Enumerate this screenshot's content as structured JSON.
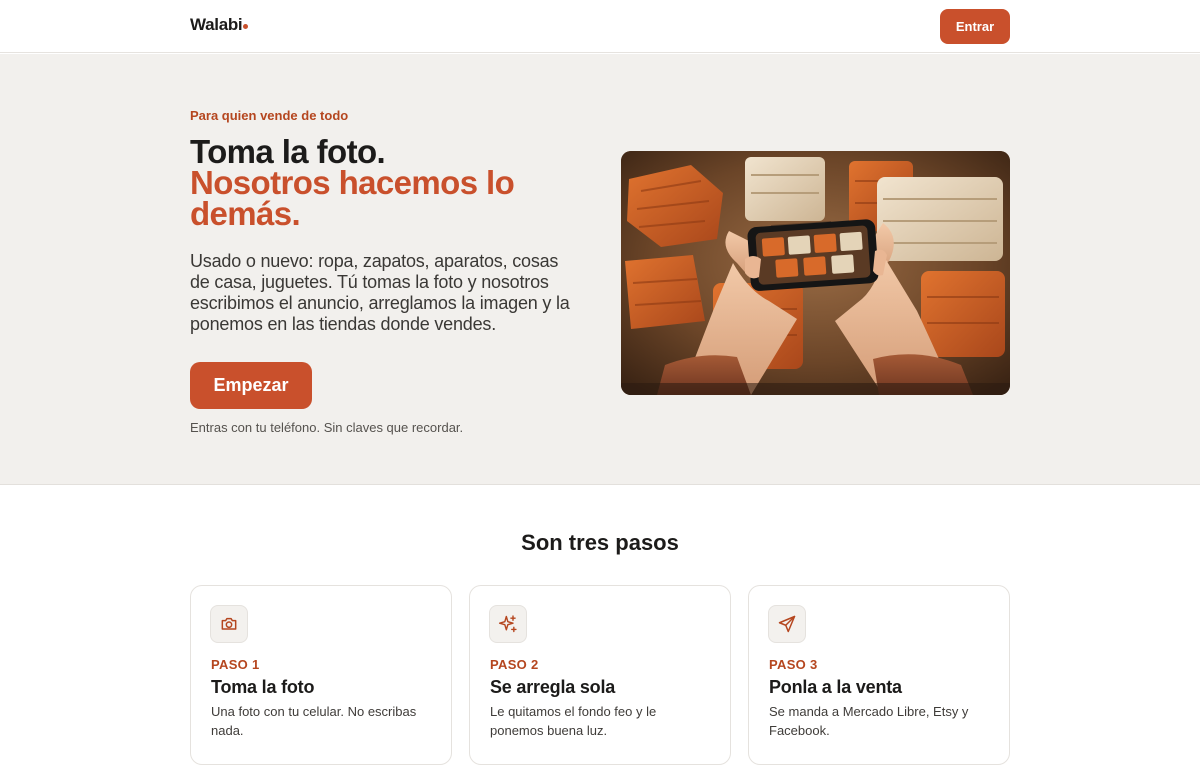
{
  "brand": {
    "name": "Walabi",
    "accent": "#c9502c"
  },
  "header": {
    "login_label": "Entrar"
  },
  "hero": {
    "eyebrow": "Para quien vende de todo",
    "title_line1": "Toma la foto.",
    "title_line2": "Nosotros hacemos lo demás.",
    "description": "Usado o nuevo: ropa, zapatos, aparatos, cosas de casa, juguetes. Tú tomas la foto y nosotros escribimos el anuncio, arreglamos la imagen y la ponemos en las tiendas donde vendes.",
    "cta_label": "Empezar",
    "note": "Entras con tu teléfono. Sin claves que recordar.",
    "image_icon": "hands-photographing-clothes-image"
  },
  "steps": {
    "title": "Son tres pasos",
    "items": [
      {
        "icon": "camera-icon",
        "label": "PASO 1",
        "title": "Toma la foto",
        "desc": "Una foto con tu celular. No escribas nada."
      },
      {
        "icon": "sparkles-icon",
        "label": "PASO 2",
        "title": "Se arregla sola",
        "desc": "Le quitamos el fondo feo y le ponemos buena luz."
      },
      {
        "icon": "send-icon",
        "label": "PASO 3",
        "title": "Ponla a la venta",
        "desc": "Se manda a Mercado Libre, Etsy y Facebook."
      }
    ]
  }
}
